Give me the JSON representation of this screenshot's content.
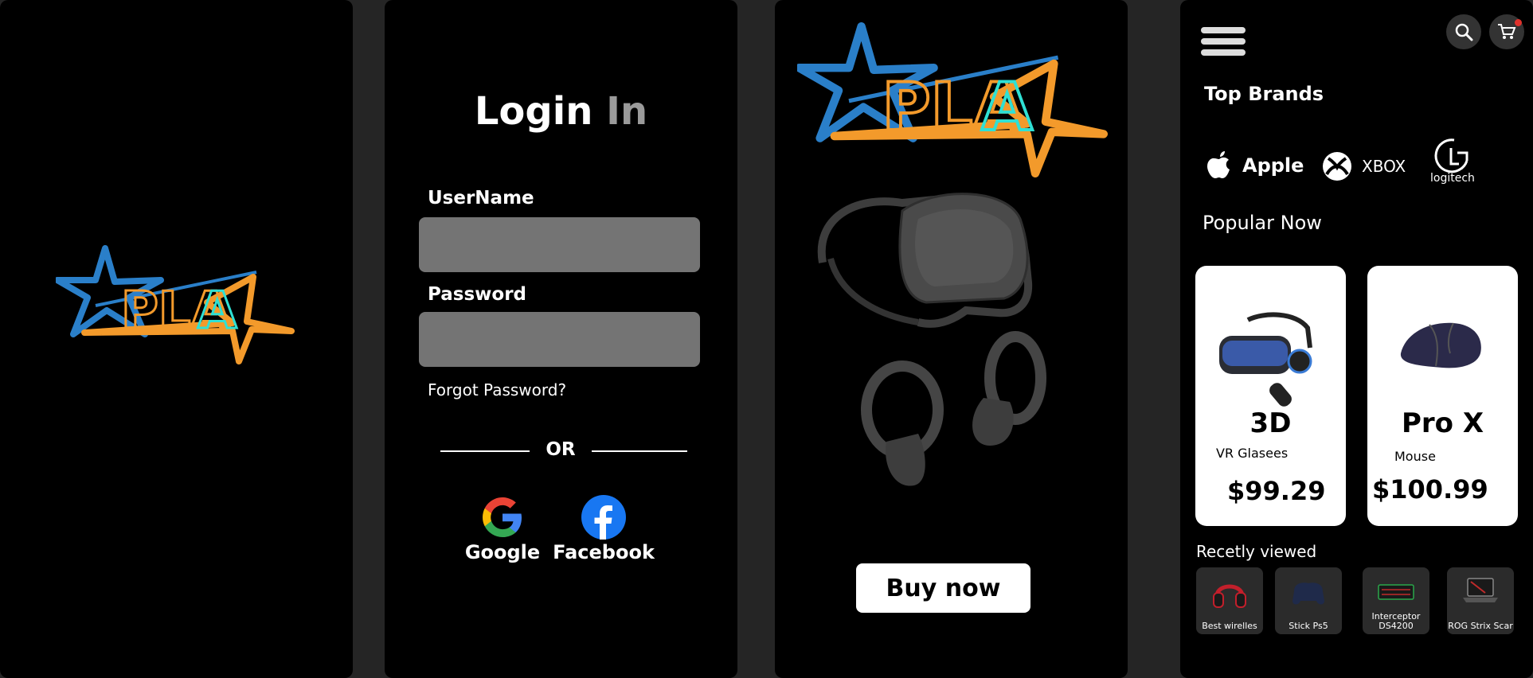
{
  "splash": {
    "logo_text": "PLA"
  },
  "login": {
    "title_main": "Login",
    "title_accent": "In",
    "username_label": "UserName",
    "username_value": "",
    "password_label": "Password",
    "password_value": "",
    "forgot_label": "Forgot Password?",
    "or_label": "OR",
    "google_label": "Google",
    "facebook_label": "Facebook"
  },
  "product": {
    "logo_text": "PLA",
    "buy_label": "Buy now"
  },
  "shop": {
    "top_brands_title": "Top Brands",
    "brands": [
      {
        "name": "Apple"
      },
      {
        "name": "XBOX"
      },
      {
        "name": "logitech"
      }
    ],
    "popular_title": "Popular Now",
    "popular": [
      {
        "name": "3D",
        "subtitle": "VR Glasees",
        "price": "$99.29"
      },
      {
        "name": "Pro X",
        "subtitle": "Mouse",
        "price": "$100.99"
      }
    ],
    "recent_title": "Recetly viewed",
    "recent": [
      {
        "label": "Best wirelles"
      },
      {
        "label": "Stick Ps5"
      },
      {
        "label": "Interceptor DS4200"
      },
      {
        "label": "ROG Strix Scar"
      }
    ]
  },
  "colors": {
    "page_bg": "#252525",
    "panel_bg": "#000000",
    "star_blue": "#2a7fc9",
    "star_orange": "#f39a2b",
    "logo_cyan": "#2fe0d4",
    "input_bg": "#747474"
  },
  "icons": [
    "apple-icon",
    "xbox-icon",
    "logitech-icon",
    "search-icon",
    "cart-icon",
    "menu-icon",
    "google-icon",
    "facebook-icon"
  ]
}
